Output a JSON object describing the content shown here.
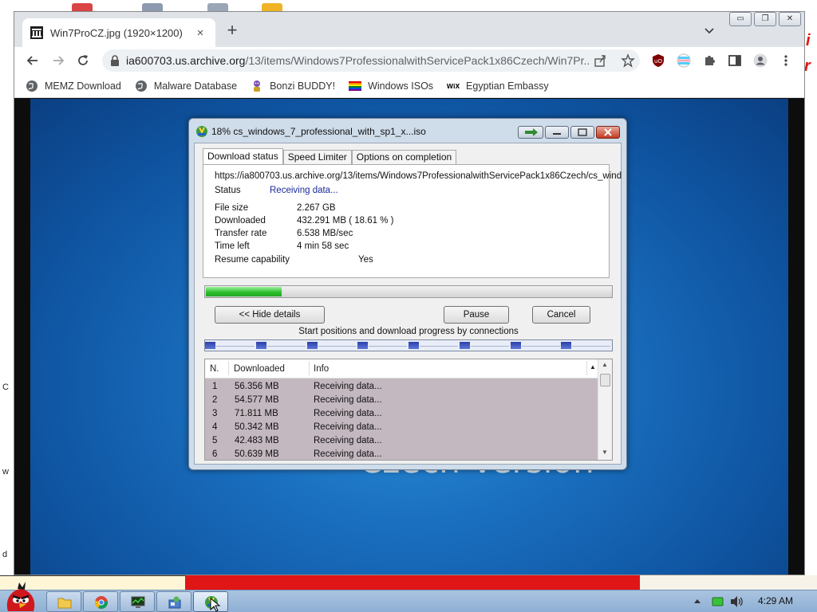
{
  "browser": {
    "tab_title": "Win7ProCZ.jpg (1920×1200)",
    "tab_close": "×",
    "new_tab": "+",
    "url_host": "ia600703.us.archive.org",
    "url_path": "/13/items/Windows7ProfessionalwithServicePack1x86Czech/Win7Pr...",
    "window_controls": {
      "minimize": "▭",
      "restore": "❐",
      "close": "✕"
    },
    "bookmarks": [
      {
        "label": "MEMZ Download",
        "icon": "globe-icon"
      },
      {
        "label": "Malware Database",
        "icon": "globe-icon"
      },
      {
        "label": "Bonzi BUDDY!",
        "icon": "bonzi-icon"
      },
      {
        "label": "Windows ISOs",
        "icon": "rainbow-flag-icon"
      },
      {
        "label": "Egyptian Embassy",
        "icon": "wix-icon"
      }
    ],
    "bookmark_wix_glyph": "WiX",
    "wallpaper_text": "Czech Version"
  },
  "dialog": {
    "title": "18% cs_windows_7_professional_with_sp1_x...iso",
    "tabs": [
      "Download status",
      "Speed Limiter",
      "Options on completion"
    ],
    "url": "https://ia800703.us.archive.org/13/items/Windows7ProfessionalwithServicePack1x86Czech/cs_wind",
    "status_label": "Status",
    "status_value": "Receiving data...",
    "details": [
      {
        "label": "File size",
        "value": "2.267  GB"
      },
      {
        "label": "Downloaded",
        "value": "432.291  MB  ( 18.61 % )"
      },
      {
        "label": "Transfer rate",
        "value": "6.538  MB/sec"
      },
      {
        "label": "Time left",
        "value": "4 min 58 sec"
      }
    ],
    "resume_label": "Resume capability",
    "resume_value": "Yes",
    "progress_fraction": 0.1861,
    "buttons": {
      "hide_details": "<< Hide details",
      "pause": "Pause",
      "cancel": "Cancel"
    },
    "connections_caption": "Start positions and download progress by connections",
    "list_headers": {
      "n": "N.",
      "downloaded": "Downloaded",
      "info": "Info"
    },
    "connections": [
      {
        "n": "1",
        "downloaded": "56.356  MB",
        "info": "Receiving data..."
      },
      {
        "n": "2",
        "downloaded": "54.577  MB",
        "info": "Receiving data..."
      },
      {
        "n": "3",
        "downloaded": "71.811  MB",
        "info": "Receiving data..."
      },
      {
        "n": "4",
        "downloaded": "50.342  MB",
        "info": "Receiving data..."
      },
      {
        "n": "5",
        "downloaded": "42.483  MB",
        "info": "Receiving data..."
      },
      {
        "n": "6",
        "downloaded": "50.639  MB",
        "info": "Receiving data..."
      }
    ]
  },
  "taskbar": {
    "clock": "4:29 AM"
  },
  "colors": {
    "progress_green": "#2ec02e",
    "status_blue": "#1a2a9a",
    "connection_blue": "#2c3fa8",
    "wallpaper_blue": "#1a6fbf",
    "row_highlight": "#c4b8c0"
  }
}
